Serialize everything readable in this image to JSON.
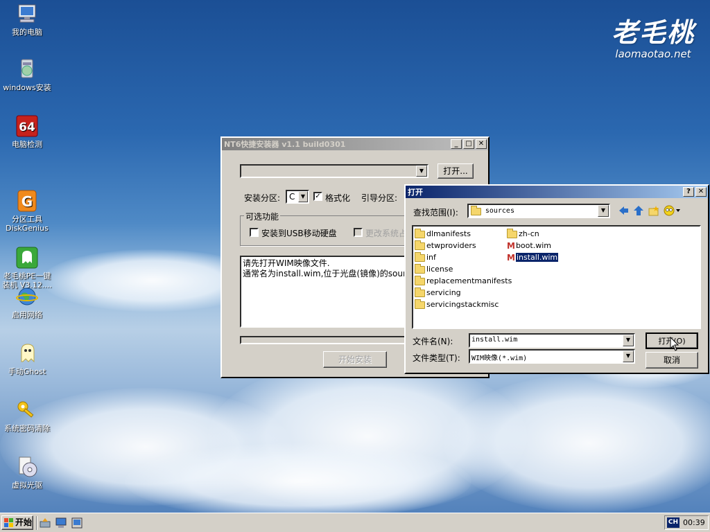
{
  "logo": {
    "main": "老毛桃",
    "sub": "laomaotao.net"
  },
  "desktop_icons": [
    {
      "label": "我的电脑"
    },
    {
      "label": "windows安装"
    },
    {
      "label": "电脑检测",
      "badge": "64"
    },
    {
      "label": "分区工具\nDiskGenius"
    },
    {
      "label": "老毛桃PE一键\n装机 V3.12...."
    },
    {
      "label": "启用网络"
    },
    {
      "label": "手动Ghost"
    },
    {
      "label": "系统密码清除"
    },
    {
      "label": "虚拟光驱"
    }
  ],
  "installer": {
    "title": "NT6快捷安装器 v1.1 build0301",
    "open_button": "打开...",
    "install_partition_label": "安装分区:",
    "install_partition_value": "C",
    "format_label": "格式化",
    "format_checked": true,
    "boot_partition_label": "引导分区:",
    "optional_group": "可选功能",
    "usb_option": "安装到USB移动硬盘",
    "change_option": "更改系统占",
    "log_line1": "请先打开WIM映像文件.",
    "log_line2": "通常名为install.wim,位于光盘(镜像)的sources",
    "start_button": "开始安装"
  },
  "open_dialog": {
    "title": "打开",
    "help_btn": "?",
    "close_btn": "✕",
    "look_in_label": "查找范围(I):",
    "look_in_value": "sources",
    "files_col1": [
      "dlmanifests",
      "etwproviders",
      "inf",
      "license",
      "replacementmanifests",
      "servicing",
      "servicingstackmisc"
    ],
    "files_col2": [
      {
        "name": "zh-cn",
        "type": "folder"
      },
      {
        "name": "boot.wim",
        "type": "wim"
      },
      {
        "name": "install.wim",
        "type": "wim",
        "selected": true
      }
    ],
    "filename_label": "文件名(N):",
    "filename_value": "install.wim",
    "filetype_label": "文件类型(T):",
    "filetype_value": "WIM映像(*.wim)",
    "open_button": "打开(O)",
    "cancel_button": "取消"
  },
  "taskbar": {
    "start_label": "开始",
    "lang": "CH",
    "clock": "00:39"
  },
  "colors": {
    "active_title": "#0a246a",
    "selection": "#0a246a",
    "face": "#d4d0c8"
  }
}
